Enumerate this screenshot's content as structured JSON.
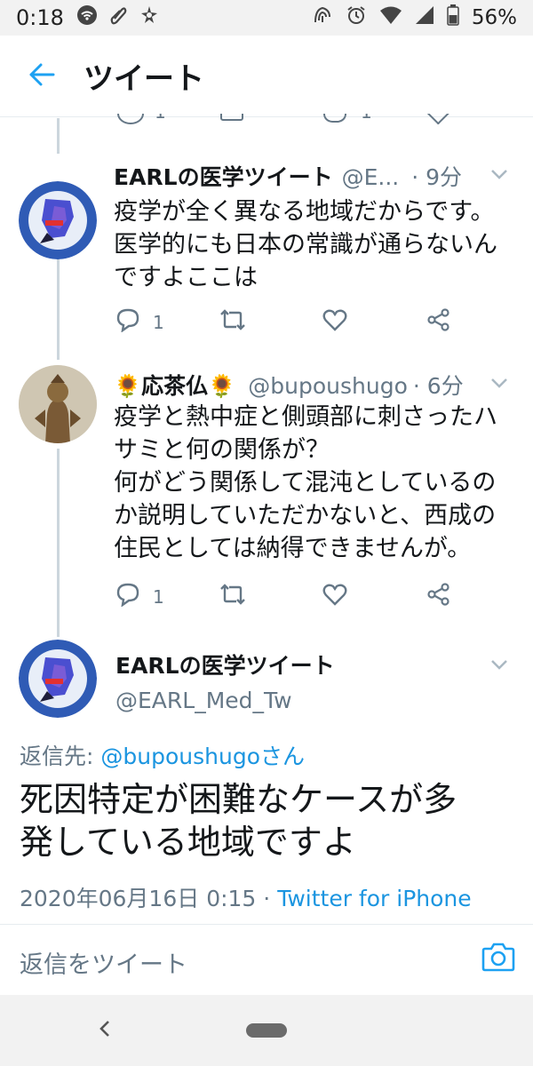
{
  "status_bar": {
    "time": "0:18",
    "battery": "56%"
  },
  "header": {
    "title": "ツイート"
  },
  "tweets": [
    {
      "name": "EARLの医学ツイート",
      "handle": "@E...",
      "time": "· 9分",
      "text_lines": [
        "疫学が全く異なる地域だからです。",
        "医学的にも日本の常識が通らないん",
        "ですよここは"
      ],
      "reply_count": "1"
    },
    {
      "name_prefix": "🌻",
      "name": "応茶仏",
      "name_suffix": "🌻",
      "handle": "@bupoushugo",
      "time": "· 6分",
      "text_lines": [
        "疫学と熱中症と側頭部に刺さったハ",
        "サミと何の関係が？",
        "何がどう関係して混沌としているの",
        "か説明していただかないと、西成の",
        "住民としては納得できませんが。"
      ],
      "reply_count": "1"
    }
  ],
  "main_tweet": {
    "name": "EARLの医学ツイート",
    "handle": "@EARL_Med_Tw",
    "reply_to_label": "返信先:",
    "reply_to_mention": "@bupoushugoさん",
    "text_lines": [
      "死因特定が困難なケースが多",
      "発している地域ですよ"
    ],
    "datetime": "2020年06月16日 0:15",
    "separator": " · ",
    "via": "Twitter for iPhone"
  },
  "composer": {
    "placeholder": "返信をツイート"
  },
  "top_partial": {
    "reply_count": "1",
    "like_count": "1"
  },
  "colors": {
    "accent": "#1da1f2",
    "muted": "#657786",
    "divider": "#e6ecf0"
  },
  "icons": [
    "wifi-icon",
    "link-icon",
    "cast-icon",
    "nfc-icon",
    "alarm-icon",
    "signal-icon",
    "battery-icon",
    "back-arrow-icon",
    "reply-icon",
    "retweet-icon",
    "like-icon",
    "share-icon",
    "chevron-down-icon",
    "camera-icon"
  ]
}
